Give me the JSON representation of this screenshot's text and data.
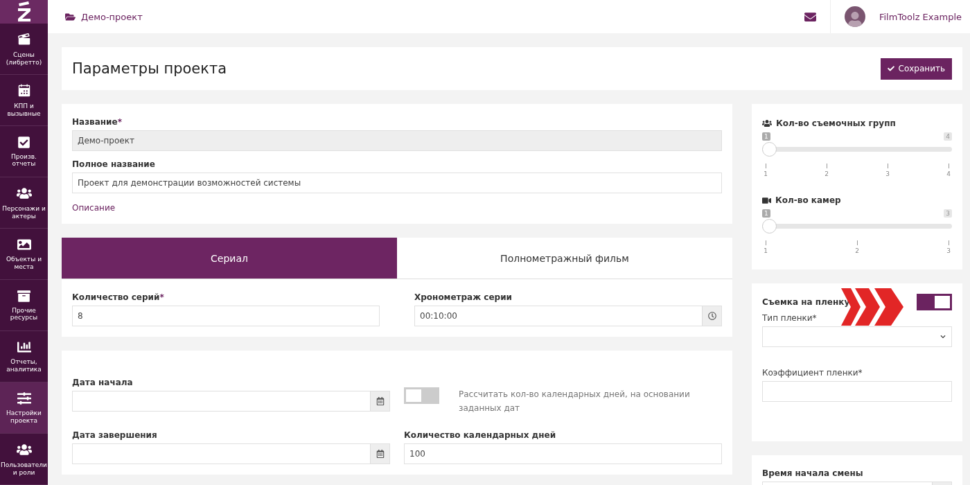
{
  "sidebar": {
    "items": [
      {
        "kind": "clapper",
        "label": "Сцены (либретто)",
        "selected": false
      },
      {
        "kind": "calendar",
        "label": "КПП и вызывные",
        "selected": false
      },
      {
        "kind": "check",
        "label": "Произв. отчеты",
        "selected": false
      },
      {
        "kind": "users",
        "label": "Персонажи и актеры",
        "selected": false
      },
      {
        "kind": "image",
        "label": "Объекты и места",
        "selected": false
      },
      {
        "kind": "archive",
        "label": "Прочие ресурсы",
        "selected": false
      },
      {
        "kind": "chart",
        "label": "Отчеты, аналитика",
        "selected": false
      },
      {
        "kind": "sliders",
        "label": "Настройки проекта",
        "selected": true
      },
      {
        "kind": "users",
        "label": "Пользователи и роли",
        "selected": false
      }
    ]
  },
  "topbar": {
    "breadcrumb": "Демо-проект",
    "user": "FilmToolz Example"
  },
  "header": {
    "title": "Параметры проекта",
    "save_button": "Сохранить"
  },
  "general": {
    "name_label": "Название",
    "name_mark": "*",
    "name_value": "Демо-проект",
    "full_label": "Полное название",
    "full_value": "Проект для демонстрации возможностей системы",
    "description_link": "Описание"
  },
  "tabs": [
    {
      "label": "Сериал",
      "selected": true
    },
    {
      "label": "Полнометражный фильм",
      "selected": false
    }
  ],
  "series": {
    "count_label": "Количество серий",
    "count_mark": "*",
    "count_value": "8",
    "duration_label": "Хронометраж серии",
    "duration_value": "00:10:00"
  },
  "dates": {
    "start_label": "Дата начала",
    "end_label": "Дата завершения",
    "calc_toggle": {
      "on": false,
      "label": "Рассчитать кол-во календарных дней, на основании заданных дат"
    },
    "days_label": "Количество календарных дней",
    "days_value": "100"
  },
  "sliders": [
    {
      "kind": "crew",
      "label": "Кол-во съемочных групп",
      "min_chip": "1",
      "max_chip": "4",
      "level": 0,
      "ticks": [
        "1",
        "2",
        "3",
        "4"
      ]
    },
    {
      "kind": "camera",
      "label": "Кол-во камер",
      "min_chip": "1",
      "max_chip": "3",
      "level": 0,
      "ticks": [
        "1",
        "2",
        "3"
      ]
    }
  ],
  "film": {
    "toggle_label": "Съемка на пленку",
    "on": true,
    "type_label": "Тип пленки*",
    "coef_label": "Коэффициент пленки*"
  },
  "shift": {
    "label": "Время начала смены"
  }
}
